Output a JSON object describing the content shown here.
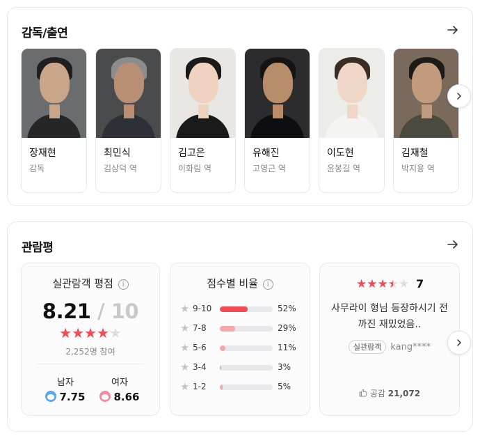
{
  "cast_section": {
    "title": "감독/출연",
    "people": [
      {
        "name": "장재현",
        "role": "감독",
        "photo": {
          "bg": "#6b6c6e",
          "skin": "#c9a58a",
          "hair": "#1f1f1f",
          "clothes": "#262626"
        }
      },
      {
        "name": "최민식",
        "role": "김상덕 역",
        "photo": {
          "bg": "#4a4b4d",
          "skin": "#b88e74",
          "hair": "#8c8c8c",
          "clothes": "#2e3038"
        }
      },
      {
        "name": "김고은",
        "role": "이화림 역",
        "photo": {
          "bg": "#e9e7e4",
          "skin": "#efd2c0",
          "hair": "#1c1a19",
          "clothes": "#1a1a1a"
        }
      },
      {
        "name": "유해진",
        "role": "고영근 역",
        "photo": {
          "bg": "#2c2c2e",
          "skin": "#b98c6c",
          "hair": "#141414",
          "clothes": "#0e0e10"
        }
      },
      {
        "name": "이도현",
        "role": "윤봉길 역",
        "photo": {
          "bg": "#ecece8",
          "skin": "#efd6c6",
          "hair": "#3a2d26",
          "clothes": "#f4f4f2"
        }
      },
      {
        "name": "김재철",
        "role": "박지용 역",
        "photo": {
          "bg": "#7a6a5c",
          "skin": "#c29a7e",
          "hair": "#1e1a17",
          "clothes": "#4a4a3e"
        }
      }
    ]
  },
  "review_section": {
    "title": "관람평",
    "rating": {
      "heading": "실관람객 평점",
      "score": "8.21",
      "max": "10",
      "stars_value": 4.1,
      "participants": "2,252명 참여",
      "male_label": "남자",
      "male_score": "7.75",
      "female_label": "여자",
      "female_score": "8.66"
    },
    "distribution": {
      "heading": "점수별 비율",
      "rows": [
        {
          "label": "9-10",
          "percent_text": "52%",
          "value": 52,
          "color": "#f24b56"
        },
        {
          "label": "7-8",
          "percent_text": "29%",
          "value": 29,
          "color": "#f6a5ab"
        },
        {
          "label": "5-6",
          "percent_text": "11%",
          "value": 11,
          "color": "#f6a5ab"
        },
        {
          "label": "3-4",
          "percent_text": "3%",
          "value": 3,
          "color": "#f6a5ab"
        },
        {
          "label": "1-2",
          "percent_text": "5%",
          "value": 5,
          "color": "#f6a5ab"
        }
      ]
    },
    "review": {
      "stars_value": 3.5,
      "score": "7",
      "text": "사무라이 형님 등장하시기 전까진 재밌었음..",
      "badge": "실관람객",
      "user": "kang****",
      "like_label": "공감",
      "like_count": "21,072"
    }
  },
  "icons": {
    "arrow": "arrow-right-icon",
    "next": "chevron-right-icon",
    "info": "info-icon",
    "star": "star-icon",
    "thumb": "thumbs-up-icon"
  },
  "colors": {
    "accent_red": "#f24b56",
    "light_red": "#f6a5ab",
    "male_blue": "#5aa6ef",
    "female_pink": "#f58aa7"
  }
}
